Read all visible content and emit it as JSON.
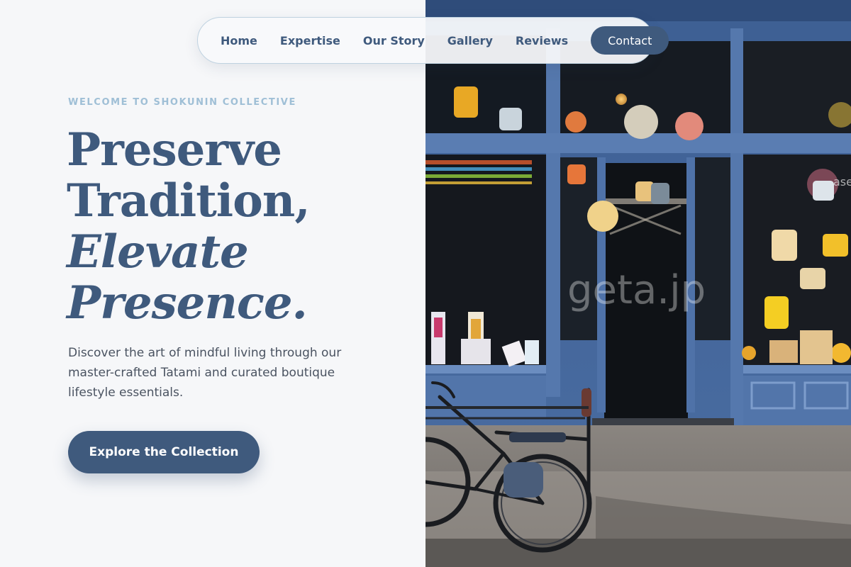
{
  "nav": {
    "items": [
      {
        "label": "Home"
      },
      {
        "label": "Expertise"
      },
      {
        "label": "Our Story"
      },
      {
        "label": "Gallery"
      },
      {
        "label": "Reviews"
      }
    ],
    "contact_label": "Contact"
  },
  "hero": {
    "eyebrow": "WELCOME TO SHOKUNIN COLLECTIVE",
    "headline_line1": "Preserve",
    "headline_line2": "Tradition,",
    "headline_line3": "Elevate",
    "headline_line4": "Presence.",
    "description": "Discover the art of mindful living through our master-crafted Tatami and curated boutique lifestyle essentials.",
    "cta_label": "Explore the Collection"
  },
  "photo": {
    "watermark": "geta.jp",
    "shop_sign_fragment": "ase"
  },
  "colors": {
    "brand": "#3f5a7d",
    "eyebrow": "#9fbfd6",
    "background": "#f6f7f9"
  }
}
